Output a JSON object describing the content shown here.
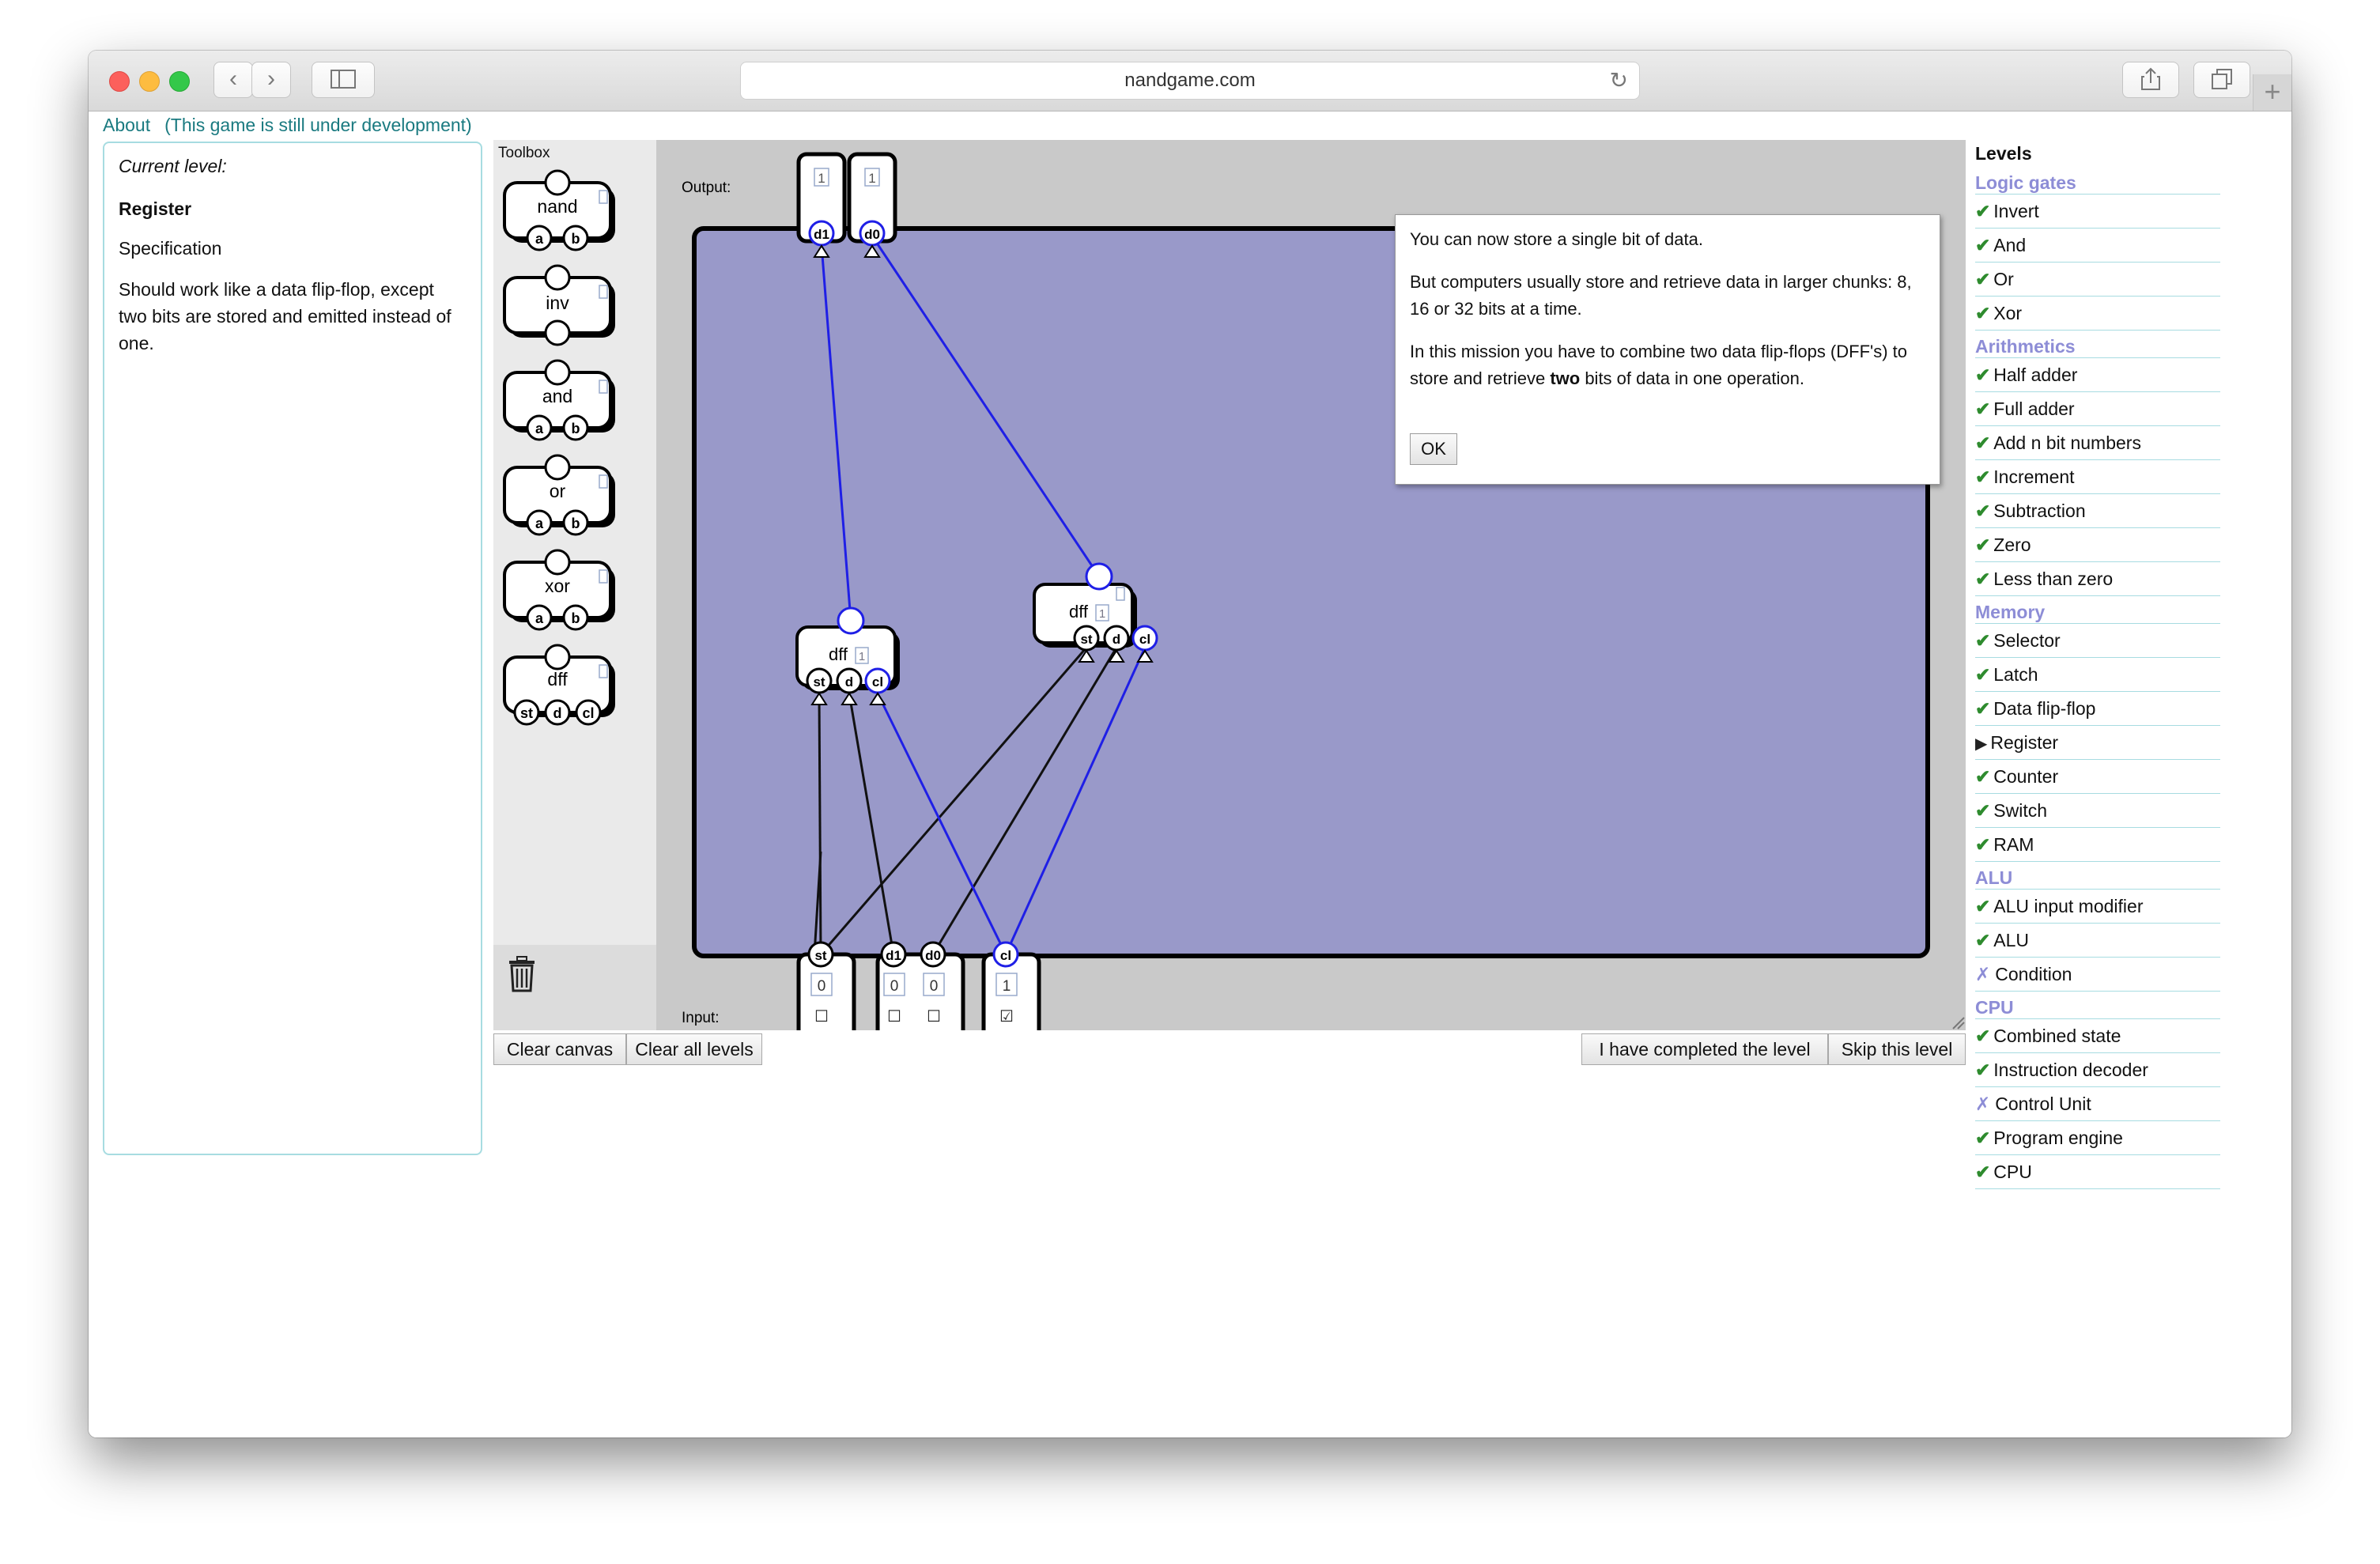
{
  "browser": {
    "url": "nandgame.com"
  },
  "top_links": {
    "about": "About",
    "note": "(This game is still under development)"
  },
  "info": {
    "current_level_label": "Current level:",
    "level_name": "Register",
    "spec_label": "Specification",
    "spec_text": "Should work like a data flip-flop, except two bits are stored and emitted instead of one."
  },
  "toolbox": {
    "label": "Toolbox",
    "components": [
      {
        "name": "nand",
        "inputs": [
          "a",
          "b"
        ]
      },
      {
        "name": "inv",
        "inputs": []
      },
      {
        "name": "and",
        "inputs": [
          "a",
          "b"
        ]
      },
      {
        "name": "or",
        "inputs": [
          "a",
          "b"
        ]
      },
      {
        "name": "xor",
        "inputs": [
          "a",
          "b"
        ]
      },
      {
        "name": "dff",
        "inputs": [
          "st",
          "d",
          "cl"
        ]
      }
    ]
  },
  "canvas": {
    "output_label": "Output:",
    "input_label": "Input:",
    "outputs": [
      {
        "name": "d1",
        "value": "1"
      },
      {
        "name": "d0",
        "value": "1"
      }
    ],
    "inputs": [
      {
        "name": "st",
        "value": "0",
        "checkbox": "☐"
      },
      {
        "name": "d1",
        "value": "0",
        "checkbox": "☐"
      },
      {
        "name": "d0",
        "value": "0",
        "checkbox": "☐"
      },
      {
        "name": "cl",
        "value": "1",
        "checkbox": "☑"
      }
    ],
    "dff_nodes": [
      {
        "label": "dff",
        "value": "1",
        "pins": [
          "st",
          "d",
          "cl"
        ]
      },
      {
        "label": "dff",
        "value": "1",
        "pins": [
          "st",
          "d",
          "cl"
        ]
      }
    ],
    "wire_colors": {
      "active": "#1f1fe6",
      "inactive": "#111111"
    },
    "board_color": "#9999c9"
  },
  "buttons": {
    "clear_canvas": "Clear canvas",
    "clear_all": "Clear all levels",
    "completed": "I have completed the level",
    "skip": "Skip this level"
  },
  "popup": {
    "p1": "You can now store a single bit of data.",
    "p2": "But computers usually store and retrieve data in larger chunks: 8, 16 or 32 bits at a time.",
    "p3_a": "In this mission you have to combine two data flip-flops (DFF's) to store and retrieve ",
    "p3_bold": "two",
    "p3_b": " bits of data in one operation.",
    "ok": "OK"
  },
  "levels": {
    "title": "Levels",
    "groups": [
      {
        "name": "Logic gates",
        "items": [
          {
            "label": "Invert",
            "status": "done"
          },
          {
            "label": "And",
            "status": "done"
          },
          {
            "label": "Or",
            "status": "done"
          },
          {
            "label": "Xor",
            "status": "done"
          }
        ]
      },
      {
        "name": "Arithmetics",
        "items": [
          {
            "label": "Half adder",
            "status": "done"
          },
          {
            "label": "Full adder",
            "status": "done"
          },
          {
            "label": "Add n bit numbers",
            "status": "done"
          },
          {
            "label": "Increment",
            "status": "done"
          },
          {
            "label": "Subtraction",
            "status": "done"
          },
          {
            "label": "Zero",
            "status": "done"
          },
          {
            "label": "Less than zero",
            "status": "done"
          }
        ]
      },
      {
        "name": "Memory",
        "items": [
          {
            "label": "Selector",
            "status": "done"
          },
          {
            "label": "Latch",
            "status": "done"
          },
          {
            "label": "Data flip-flop",
            "status": "done"
          },
          {
            "label": "Register",
            "status": "current"
          },
          {
            "label": "Counter",
            "status": "done"
          },
          {
            "label": "Switch",
            "status": "done"
          },
          {
            "label": "RAM",
            "status": "done"
          }
        ]
      },
      {
        "name": "ALU",
        "items": [
          {
            "label": "ALU input modifier",
            "status": "done"
          },
          {
            "label": "ALU",
            "status": "done"
          },
          {
            "label": "Condition",
            "status": "failed"
          }
        ]
      },
      {
        "name": "CPU",
        "items": [
          {
            "label": "Combined state",
            "status": "done"
          },
          {
            "label": "Instruction decoder",
            "status": "done"
          },
          {
            "label": "Control Unit",
            "status": "failed"
          },
          {
            "label": "Program engine",
            "status": "done"
          },
          {
            "label": "CPU",
            "status": "done"
          }
        ]
      }
    ]
  }
}
